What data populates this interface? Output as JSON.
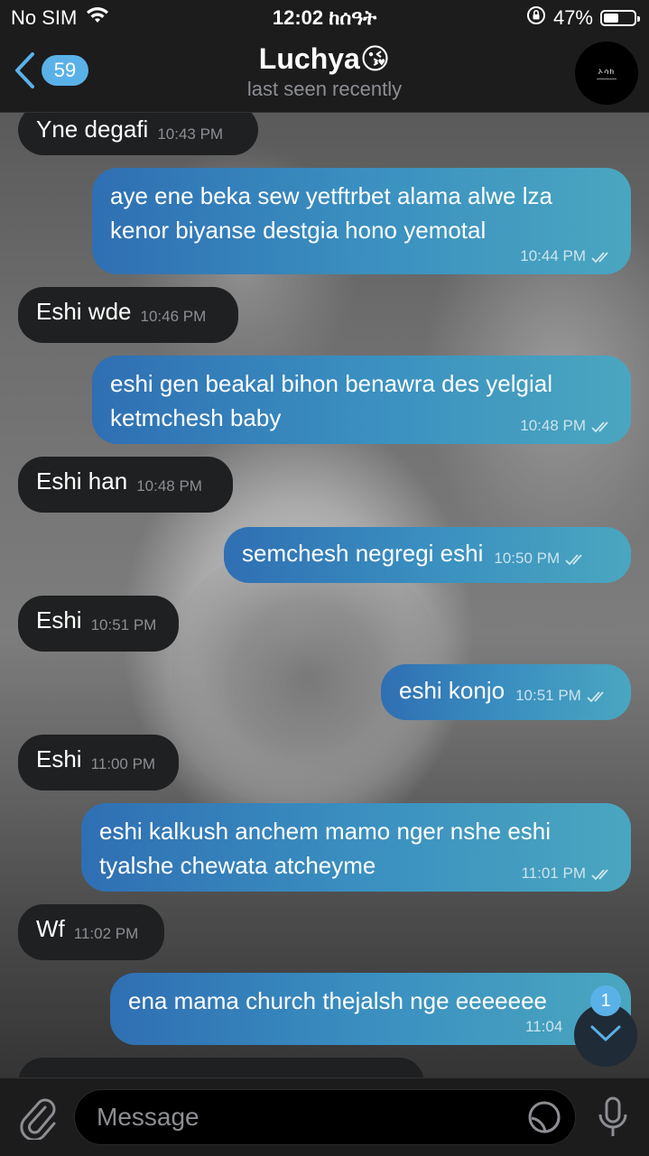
{
  "status_bar": {
    "carrier": "No SIM",
    "time": "12:02 ከሰዓት",
    "battery": "47%"
  },
  "header": {
    "back_count": "59",
    "title": "Luchya😘",
    "subtitle": "last seen recently"
  },
  "messages": [
    {
      "dir": "in",
      "text": "Yne degafi",
      "time": "10:43 PM"
    },
    {
      "dir": "out",
      "text": "aye ene beka sew yetftrbet alama alwe lza kenor biyanse destgia hono yemotal",
      "time": "10:44 PM"
    },
    {
      "dir": "in",
      "text": "Eshi wde",
      "time": "10:46 PM"
    },
    {
      "dir": "out",
      "text": "eshi gen beakal bihon benawra des yelgial ketmchesh baby",
      "time": "10:48 PM"
    },
    {
      "dir": "in",
      "text": "Eshi han",
      "time": "10:48 PM"
    },
    {
      "dir": "out",
      "text": "semchesh negregi eshi",
      "time": "10:50 PM"
    },
    {
      "dir": "in",
      "text": "Eshi",
      "time": "10:51 PM"
    },
    {
      "dir": "out",
      "text": "eshi konjo",
      "time": "10:51 PM"
    },
    {
      "dir": "in",
      "text": "Eshi",
      "time": "11:00 PM"
    },
    {
      "dir": "out",
      "text": "eshi kalkush anchem mamo nger nshe eshi tyalshe chewata atcheyme",
      "time": "11:01 PM"
    },
    {
      "dir": "in",
      "text": "Wf",
      "time": "11:02 PM"
    },
    {
      "dir": "out",
      "text": "ena mama church thejalsh nge eeeeeee",
      "time": "11:04"
    }
  ],
  "scroll_down": {
    "unread": "1"
  },
  "input_bar": {
    "placeholder": "Message"
  },
  "colors": {
    "accent": "#5ab1e8",
    "incoming_bubble": "#1f2021",
    "outgoing_bubble_start": "#2f6fb3",
    "outgoing_bubble_end": "#4aa6c0",
    "bar_background": "#1c1c1d"
  },
  "icons": [
    "wifi-icon",
    "lock-rotation-icon",
    "battery-icon",
    "chevron-left-icon",
    "paperclip-icon",
    "sticker-icon",
    "microphone-icon",
    "chevron-down-icon",
    "double-check-icon"
  ]
}
